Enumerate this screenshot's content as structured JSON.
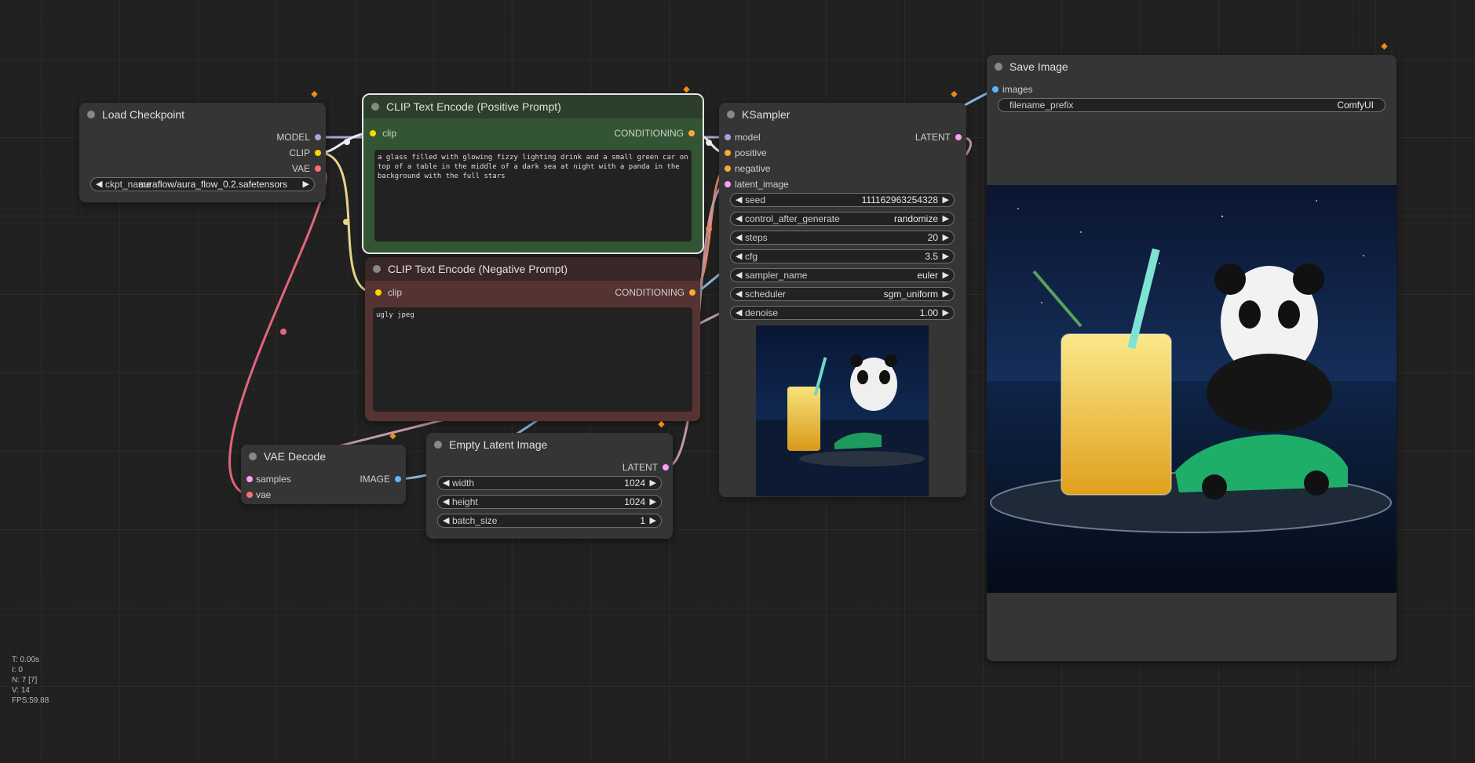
{
  "colors": {
    "canvas": "#202020",
    "node_bg": "#353535",
    "positive_title": "#2b3f2b",
    "positive_body": "#335533",
    "negative_title": "#3a2727",
    "negative_body": "#553333",
    "model_link": "#b39ddb",
    "clip_link": "#ffd500",
    "vae_link": "#ff6e6e",
    "latent_link": "#ff9cf9",
    "image_link": "#64b5f6",
    "conditioning_link": "#ffa931"
  },
  "load_checkpoint": {
    "title": "Load Checkpoint",
    "outputs": [
      "MODEL",
      "CLIP",
      "VAE"
    ],
    "ckpt_label": "ckpt_name",
    "ckpt_value": "auraflow/aura_flow_0.2.safetensors"
  },
  "clip_positive": {
    "title": "CLIP Text Encode (Positive Prompt)",
    "input": "clip",
    "output": "CONDITIONING",
    "text": "a glass filled with glowing fizzy lighting drink and a small green car on top of a table in the middle of a dark sea at night with a panda in the background with the full stars"
  },
  "clip_negative": {
    "title": "CLIP Text Encode (Negative Prompt)",
    "input": "clip",
    "output": "CONDITIONING",
    "text": "ugly jpeg"
  },
  "ksampler": {
    "title": "KSampler",
    "inputs": [
      "model",
      "positive",
      "negative",
      "latent_image"
    ],
    "output": "LATENT",
    "widgets": [
      {
        "label": "seed",
        "value": "111162963254328"
      },
      {
        "label": "control_after_generate",
        "value": "randomize"
      },
      {
        "label": "steps",
        "value": "20"
      },
      {
        "label": "cfg",
        "value": "3.5"
      },
      {
        "label": "sampler_name",
        "value": "euler"
      },
      {
        "label": "scheduler",
        "value": "sgm_uniform"
      },
      {
        "label": "denoise",
        "value": "1.00"
      }
    ]
  },
  "vae_decode": {
    "title": "VAE Decode",
    "inputs": [
      "samples",
      "vae"
    ],
    "output": "IMAGE"
  },
  "empty_latent": {
    "title": "Empty Latent Image",
    "output": "LATENT",
    "widgets": [
      {
        "label": "width",
        "value": "1024"
      },
      {
        "label": "height",
        "value": "1024"
      },
      {
        "label": "batch_size",
        "value": "1"
      }
    ]
  },
  "save_image": {
    "title": "Save Image",
    "input": "images",
    "prefix_label": "filename_prefix",
    "prefix_value": "ComfyUI"
  },
  "stats": [
    "T: 0.00s",
    "I: 0",
    "N: 7 [7]",
    "V: 14",
    "FPS:59.88"
  ],
  "icons": {
    "node_badge": "fox-badge-icon",
    "arrow_left": "triangle-left-icon",
    "arrow_right": "triangle-right-icon"
  }
}
